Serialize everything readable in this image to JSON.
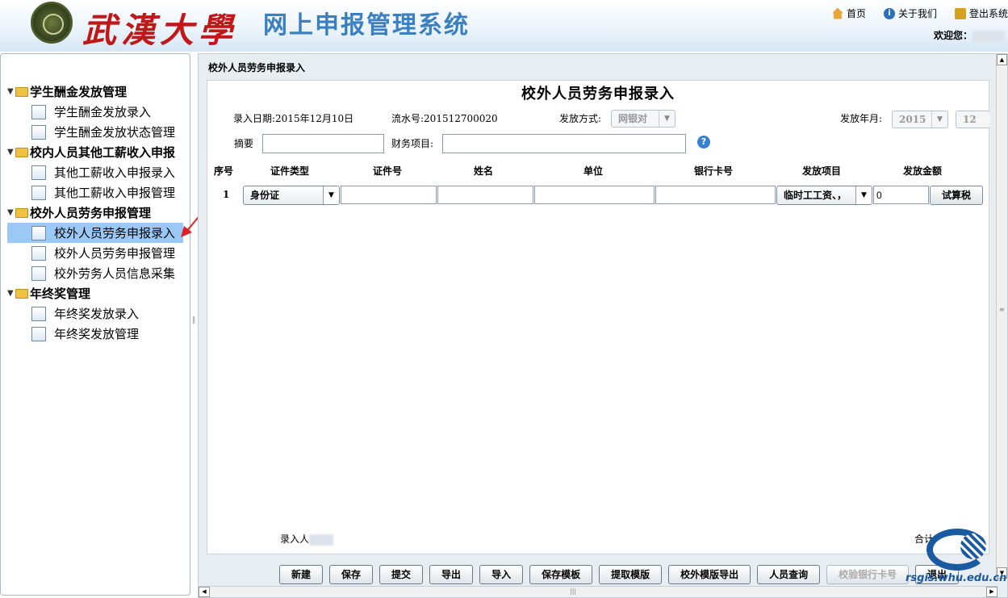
{
  "header": {
    "university_name": "武漢大學",
    "system_title": "网上申报管理系统",
    "links": [
      {
        "label": "首页",
        "icon": "home-icon"
      },
      {
        "label": "关于我们",
        "icon": "info-icon"
      },
      {
        "label": "登出系统",
        "icon": "lock-icon"
      }
    ],
    "welcome_label": "欢迎您："
  },
  "sidebar": {
    "groups": [
      {
        "label": "学生酬金发放管理",
        "items": [
          "学生酬金发放录入",
          "学生酬金发放状态管理"
        ]
      },
      {
        "label": "校内人员其他工薪收入申报",
        "items": [
          "其他工薪收入申报录入",
          "其他工薪收入申报管理"
        ]
      },
      {
        "label": "校外人员劳务申报管理",
        "items": [
          "校外人员劳务申报录入",
          "校外人员劳务申报管理",
          "校外劳务人员信息采集"
        ]
      },
      {
        "label": "年终奖管理",
        "items": [
          "年终奖发放录入",
          "年终奖发放管理"
        ]
      }
    ],
    "selected_item": "校外人员劳务申报录入"
  },
  "content": {
    "breadcrumb": "校外人员劳务申报录入",
    "form_title": "校外人员劳务申报录入",
    "entry_date": "录入日期:2015年12月10日",
    "serial_no": "流水号:201512700020",
    "pay_method_label": "发放方式:",
    "pay_method_value": "网银对",
    "pay_ym_label": "发放年月:",
    "pay_year": "2015",
    "pay_month": "12",
    "summary_label": "摘要",
    "finance_label": "财务项目:",
    "columns": [
      "序号",
      "证件类型",
      "证件号",
      "姓名",
      "单位",
      "银行卡号",
      "发放项目",
      "发放金额"
    ],
    "row": {
      "index": "1",
      "id_type": "身份证",
      "pay_item": "临时工工资、，",
      "amount": "0",
      "calc_button": "试算税"
    },
    "entered_by_label": "录入人",
    "total_label": "合计"
  },
  "buttons": [
    "新建",
    "保存",
    "提交",
    "导出",
    "导入",
    "保存模板",
    "提取模版",
    "校外模版导出",
    "人员查询",
    "校验银行卡号",
    "退出"
  ],
  "watermark": "rsgis.whu.edu.cn"
}
